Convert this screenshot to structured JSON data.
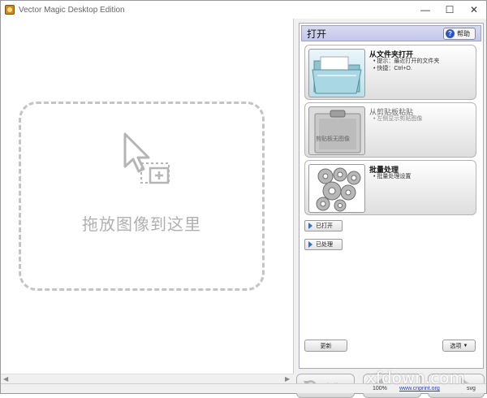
{
  "window": {
    "title": "Vector Magic Desktop Edition"
  },
  "controls": {
    "minimize": "—",
    "maximize": "☐",
    "close": "✕"
  },
  "canvas": {
    "drop_label": "拖放图像到这里"
  },
  "panel": {
    "title": "打开",
    "help_label": "帮助",
    "help_icon": "?",
    "cards": [
      {
        "title": "从文件夹打开",
        "lines": [
          "提示：最近打开的文件夹",
          "快捷：Ctrl+O."
        ],
        "icon": "folder-icon"
      },
      {
        "title": "从剪贴板粘贴",
        "lines": [
          "左侧显示剪贴图像"
        ],
        "icon": "clipboard-icon",
        "clip_text": "剪贴板无图像"
      },
      {
        "title": "批量处理",
        "lines": [
          "批量处理设置"
        ],
        "icon": "gears-icon"
      }
    ],
    "opened_label": "已打开",
    "processed_label": "已处理",
    "update_label": "更新",
    "options_label": "选项"
  },
  "nav": {
    "reset_label": "复位"
  },
  "status": {
    "zoom": "100%",
    "link": "www.cnprint.org",
    "format": "svg"
  },
  "watermark": "xfdown.com"
}
